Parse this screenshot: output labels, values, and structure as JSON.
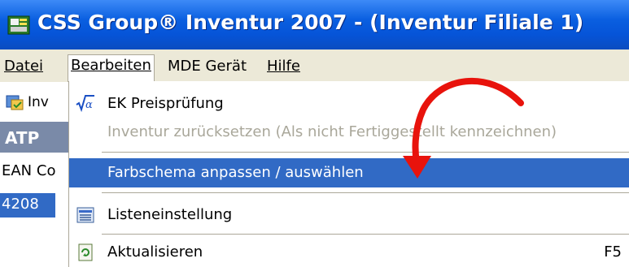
{
  "window": {
    "title": "CSS Group® Inventur 2007 - (Inventur Filiale 1)"
  },
  "menubar": {
    "items": [
      {
        "label": "Datei"
      },
      {
        "label": "Bearbeiten"
      },
      {
        "label": "MDE Gerät"
      },
      {
        "label": "Hilfe"
      }
    ]
  },
  "background": {
    "toolbar_text": "Inv",
    "column_header": "ATP",
    "ean_label": "EAN Co",
    "selected_cell": "4208"
  },
  "dropdown": {
    "items": [
      {
        "label": "EK Preisprüfung",
        "icon": "sqrt-alpha-icon",
        "state": "normal"
      },
      {
        "label": "Inventur zurücksetzen (Als nicht Fertiggestellt kennzeichnen)",
        "icon": "",
        "state": "disabled"
      },
      {
        "label": "Farbschema anpassen / auswählen",
        "icon": "",
        "state": "highlighted"
      },
      {
        "label": "Listeneinstellung",
        "icon": "list-settings-icon",
        "state": "normal"
      },
      {
        "label": "Aktualisieren",
        "icon": "refresh-icon",
        "state": "normal",
        "shortcut": "F5"
      }
    ]
  },
  "colors": {
    "titlebar": "#0654d8",
    "highlight": "#316ac5",
    "annotation_arrow": "#e8130c"
  }
}
